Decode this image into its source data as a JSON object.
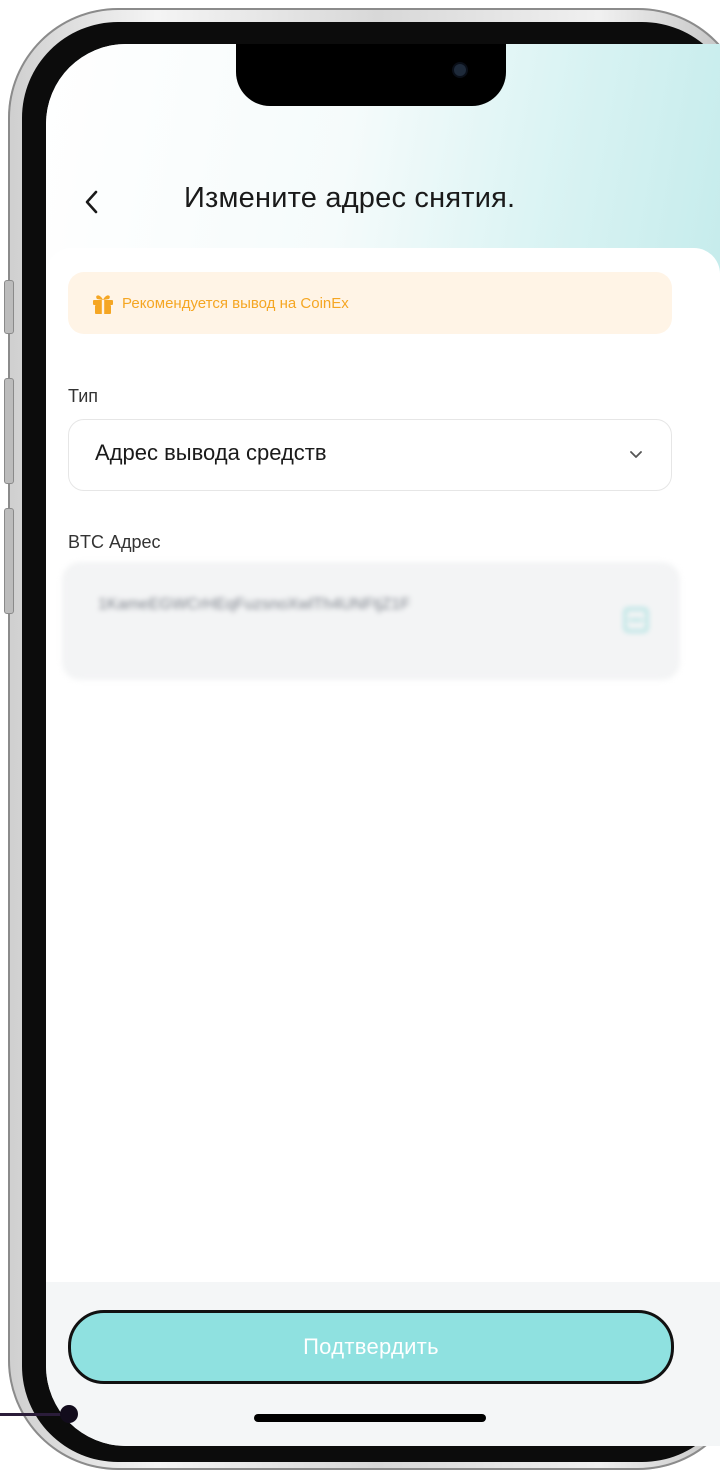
{
  "header": {
    "title": "Измените адрес снятия."
  },
  "promo": {
    "text": "Рекомендуется вывод на CoinEx",
    "icon": "gift-icon",
    "color": "#f5a623"
  },
  "type_field": {
    "label": "Тип",
    "value": "Адрес вывода средств"
  },
  "address_field": {
    "label": "BTC Адрес",
    "value": "1KameEGWCrHEqFuzsnoXwlTh4UNFtjZ1F",
    "blurred": true
  },
  "confirm_button": {
    "label": "Подтвердить",
    "color": "#8fe1e0"
  },
  "colors": {
    "accent": "#8fe1e0",
    "promo_bg": "#fff4e6"
  }
}
